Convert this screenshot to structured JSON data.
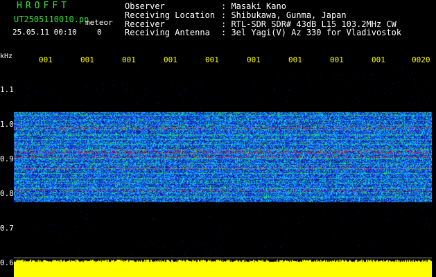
{
  "header": {
    "app_title": "HROFFT",
    "file_name": "UT2505110010.pn",
    "meteor_label": "meteor",
    "date_time": "25.05.11 00:10",
    "marker": "0"
  },
  "info": [
    {
      "key": "Observer",
      "value": ": Masaki Kano"
    },
    {
      "key": "Receiving Location",
      "value": ": Shibukawa, Gunma, Japan"
    },
    {
      "key": "Receiver",
      "value": ": RTL-SDR SDR# 43dB L15 103.2MHz CW"
    },
    {
      "key": "Receiving Antenna",
      "value": ": 3el Yagi(V) Az 330 for Vladivostok"
    }
  ],
  "axis": {
    "unit": "kHz",
    "time_ticks": [
      "001",
      "001",
      "001",
      "001",
      "001",
      "001",
      "001",
      "001",
      "001",
      "0020"
    ],
    "freq_ticks": [
      "1.1",
      "1.0",
      "0.9",
      "0.8",
      "0.7",
      "0.6"
    ]
  },
  "colors": {
    "background": "#000000",
    "title_green": "#33e233",
    "tick_yellow": "#ffff00",
    "amplitude_yellow": "#ffff00",
    "band_dark_blue": "#0a1a8c",
    "band_blue": "#1e5aff",
    "band_cyan": "#00d2ff",
    "band_green": "#3cdc32",
    "line_red": "#ff2a2a"
  }
}
